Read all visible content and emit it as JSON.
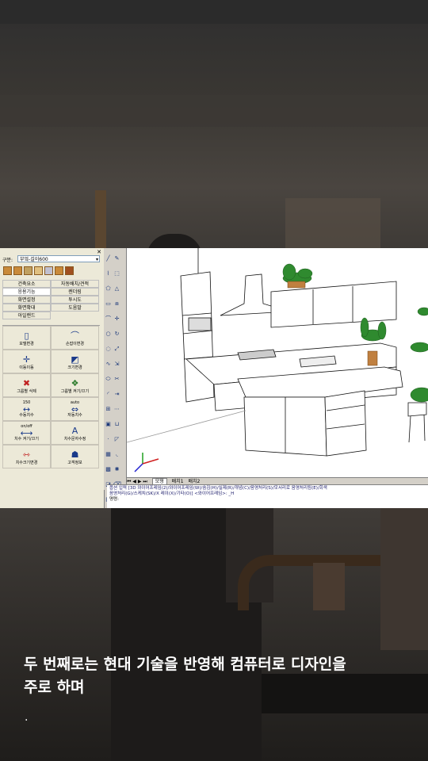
{
  "cad_panel": {
    "label_classification": "구분:",
    "classification_value": "부엌-길이600",
    "close_icon": "✕",
    "menu": [
      [
        "건축요소",
        "자동배치/견적"
      ],
      [
        "응용기능",
        "렌더링"
      ],
      [
        "화면설정",
        "투시도"
      ],
      [
        "화면확대",
        "도움말"
      ],
      [
        "아일랜드",
        ""
      ]
    ],
    "tools": [
      {
        "label": "모델변경",
        "icon": "▯"
      },
      {
        "label": "손잡이변경",
        "icon": "⌒"
      },
      {
        "label": "이동이동",
        "icon": "✛"
      },
      {
        "label": "크기변경",
        "icon": "◩"
      },
      {
        "label": "그룹별 삭제",
        "icon": "✖"
      },
      {
        "label": "그룹별 켜기/끄기",
        "icon": "❖"
      },
      {
        "label": "수동치수",
        "icon": "↔"
      },
      {
        "label": "자동치수",
        "icon": "⇔"
      },
      {
        "label": "치수 켜기/끄기",
        "icon": "⟷"
      },
      {
        "label": "치수문자수정",
        "icon": "A"
      },
      {
        "label": "치수크기변경",
        "icon": "⇿"
      },
      {
        "label": "고객정보",
        "icon": "☗"
      }
    ],
    "tool_tags": {
      "dim_manual": "150",
      "dim_auto": "auto",
      "dim_onoff": "on/off"
    }
  },
  "layout_tabs": {
    "nav": "⏮ ◀ ▶ ⏭",
    "model": "모형",
    "layout1": "배치1",
    "layout2": "배치2"
  },
  "command": {
    "line1": "옵션 입력 [3D 와이어프레임(2)/와이어프레임(W)/숨김(H)/실제(R)/개념(C)/음영처리(S)/모서리로 음영처리됨(E)/회색",
    "line2": "음영처리(G)/스케치(SK)/X 레이(X)/기타(O)] <와이어프레임>: _H",
    "prompt": "명령:"
  },
  "caption": {
    "line1": "두 번째로는 현대 기술을 반영해 컴퓨터로 디자인을",
    "line2": "주로 하며",
    "dot": "."
  }
}
